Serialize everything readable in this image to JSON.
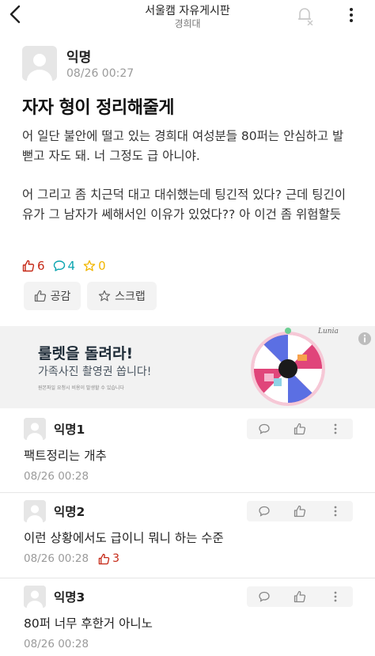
{
  "header": {
    "title": "서울캠 자유게시판",
    "subtitle": "경희대"
  },
  "post": {
    "author": "익명",
    "time": "08/26 00:27",
    "title": "자자 형이 정리해줄게",
    "body": [
      "어 일단 불안에 떨고 있는 경희대 여성분들 80퍼는 안심하고 발뻗고 자도 돼. 너 그정도 급 아니야.",
      "어 그리고 좀 치근덕 대고 대쉬했는데 팅긴적 있다? 근데 팅긴이유가 그 남자가 쎄해서인 이유가 있었다?? 아 이건 좀 위험할듯"
    ],
    "likes": "6",
    "comments": "4",
    "scraps": "0",
    "like_button": "공감",
    "scrap_button": "스크랩"
  },
  "ad": {
    "title": "룰렛을 돌려라!",
    "description": "가족사진 촬영권 쏩니다!",
    "fine_print": "원본파일 요청시 비용이 발생할 수 있습니다",
    "logo": "Lunia"
  },
  "comments": [
    {
      "author": "익명1",
      "text": "팩트정리는 개추",
      "time": "08/26 00:28",
      "likes": ""
    },
    {
      "author": "익명2",
      "text": "이런 상황에서도 급이니 뭐니 하는 수준",
      "time": "08/26 00:28",
      "likes": "3"
    },
    {
      "author": "익명3",
      "text": "80퍼 너무 후한거 아니노",
      "time": "08/26 00:28",
      "likes": ""
    }
  ],
  "colors": {
    "like": "#c62917",
    "comment": "#0ca5b0",
    "scrap": "#f2b600"
  }
}
